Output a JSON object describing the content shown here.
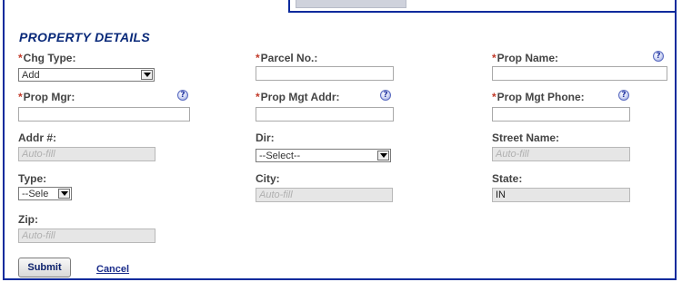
{
  "section": {
    "title": "PROPERTY DETAILS"
  },
  "required_marker": "*",
  "fields": {
    "chg_type": {
      "label": "Chg Type:",
      "value": "Add"
    },
    "parcel_no": {
      "label": "Parcel No.:",
      "value": ""
    },
    "prop_name": {
      "label": "Prop Name:",
      "value": ""
    },
    "prop_mgr": {
      "label": "Prop Mgr:",
      "value": ""
    },
    "prop_mgt_addr": {
      "label": "Prop Mgt Addr:",
      "value": ""
    },
    "prop_mgt_phone": {
      "label": "Prop Mgt Phone:",
      "value": ""
    },
    "addr_no": {
      "label": "Addr #:",
      "placeholder": "Auto-fill"
    },
    "dir": {
      "label": "Dir:",
      "value": "--Select--"
    },
    "street_name": {
      "label": "Street Name:",
      "placeholder": "Auto-fill"
    },
    "type": {
      "label": "Type:",
      "value": "--Sele"
    },
    "city": {
      "label": "City:",
      "placeholder": "Auto-fill"
    },
    "state": {
      "label": "State:",
      "value": "IN"
    },
    "zip": {
      "label": "Zip:",
      "placeholder": "Auto-fill"
    }
  },
  "help_icon_text": "?",
  "actions": {
    "submit": "Submit",
    "cancel": "Cancel"
  },
  "colors": {
    "heading": "#0a2a7a",
    "required": "#c23b2a",
    "frame": "#0a2a9c",
    "readonly_bg": "#e6e6e6"
  }
}
